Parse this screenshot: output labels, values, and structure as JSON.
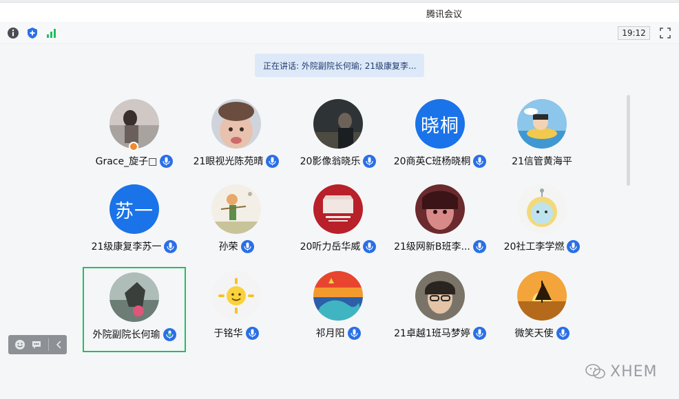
{
  "window": {
    "title": "腾讯会议"
  },
  "toolbar": {
    "time": "19:12",
    "info_icon": "info-icon",
    "shield_icon": "shield-icon",
    "signal_icon": "signal-icon",
    "fullscreen_icon": "fullscreen-icon"
  },
  "speaking_banner": "正在讲话: 外院副院长何瑜; 21级康复李...",
  "participants": [
    {
      "name": "Grace_旋子□",
      "avatar": "photo",
      "host": true
    },
    {
      "name": "21眼视光陈苑晴",
      "avatar": "photo"
    },
    {
      "name": "20影像翁晓乐",
      "avatar": "photo"
    },
    {
      "name": "20商英C班杨晓桐",
      "avatar": "text",
      "avatar_text": "晓桐"
    },
    {
      "name": "21信管黄海平",
      "avatar": "photo",
      "mic": false
    },
    {
      "name": "21级康复李苏一",
      "avatar": "text",
      "avatar_text": "苏一"
    },
    {
      "name": "孙荣",
      "avatar": "photo"
    },
    {
      "name": "20听力岳华威",
      "avatar": "photo"
    },
    {
      "name": "21级网新B班李...",
      "avatar": "photo"
    },
    {
      "name": "20社工李学燃",
      "avatar": "photo"
    },
    {
      "name": "外院副院长何瑜",
      "avatar": "photo",
      "active": true,
      "speaking": true
    },
    {
      "name": "于铭华",
      "avatar": "photo"
    },
    {
      "name": "祁月阳",
      "avatar": "photo"
    },
    {
      "name": "21卓越1班马梦婷",
      "avatar": "photo"
    },
    {
      "name": "微笑天使",
      "avatar": "photo"
    }
  ],
  "watermark": "XHEM",
  "colors": {
    "accent": "#2a6fe6",
    "active_border": "#1fbf5f",
    "speaking_bg": "#dde9f8"
  }
}
